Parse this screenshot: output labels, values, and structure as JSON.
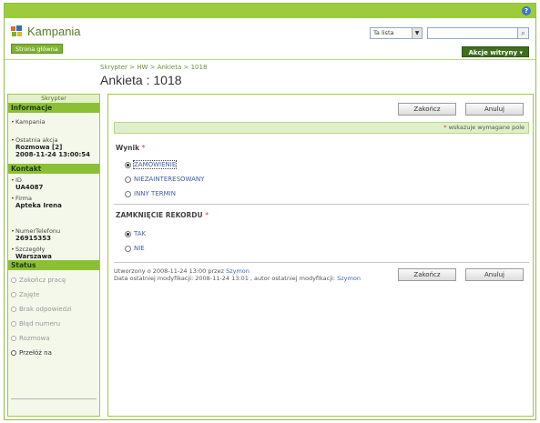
{
  "app": {
    "title": "Kampania",
    "home_button": "Strona główna"
  },
  "colors": {
    "accent": "#9ccc3c",
    "dark_accent": "#3f6e1e",
    "required": "#d43a1e",
    "link": "#3b68b0"
  },
  "search": {
    "scope": "Ta lista",
    "value": ""
  },
  "site_actions": "Akcje witryny",
  "breadcrumb": "Skrypter > HW > Ankieta > 1018",
  "page_title": "Ankieta : 1018",
  "sidebar": {
    "caption": "Skrypter",
    "sections": {
      "info": "Informacje",
      "contact": "Kontakt",
      "status": "Status"
    },
    "info_items": [
      {
        "label": "Kampania",
        "value": ""
      },
      {
        "label": "Ostatnia akcja",
        "value": "Rozmowa [2]",
        "value2": "2008-11-24 13:00:54"
      }
    ],
    "contact_items": [
      {
        "label": "ID",
        "value": "UA4087"
      },
      {
        "label": "Firma",
        "value": "Apteka Irena"
      },
      {
        "label": "NumerTelefonu",
        "value": "26915353"
      },
      {
        "label": "Szczegóły",
        "value": "Warszawa"
      }
    ],
    "status_items": [
      {
        "label": "Zakończ pracę",
        "enabled": false
      },
      {
        "label": "Zajęte",
        "enabled": false
      },
      {
        "label": "Brak odpowiedzi",
        "enabled": false
      },
      {
        "label": "Błąd numeru",
        "enabled": false
      },
      {
        "label": "Rozmowa",
        "enabled": false
      },
      {
        "label": "Przełóż na",
        "enabled": true
      }
    ]
  },
  "form": {
    "finish_label": "Zakończ",
    "cancel_label": "Anuluj",
    "required_note": "wskazuje wymagane pole",
    "fields": [
      {
        "label": "Wynik",
        "options": [
          "ZAMÓWIENIE",
          "NIEZAINTERESOWANY",
          "INNY TERMIN"
        ],
        "selected": "ZAMÓWIENIE"
      },
      {
        "label": "ZAMKNIĘCIE REKORDU",
        "options": [
          "TAK",
          "NIE"
        ],
        "selected": "TAK"
      }
    ],
    "meta": {
      "created_prefix": "Utworzony o 2008-11-24 13:00  przez",
      "created_by": "Szymon",
      "modified_prefix": "Data ostatniej modyfikacji: 2008-11-24 13:01 , autor ostatniej modyfikacji:",
      "modified_by": "Szymon"
    }
  }
}
